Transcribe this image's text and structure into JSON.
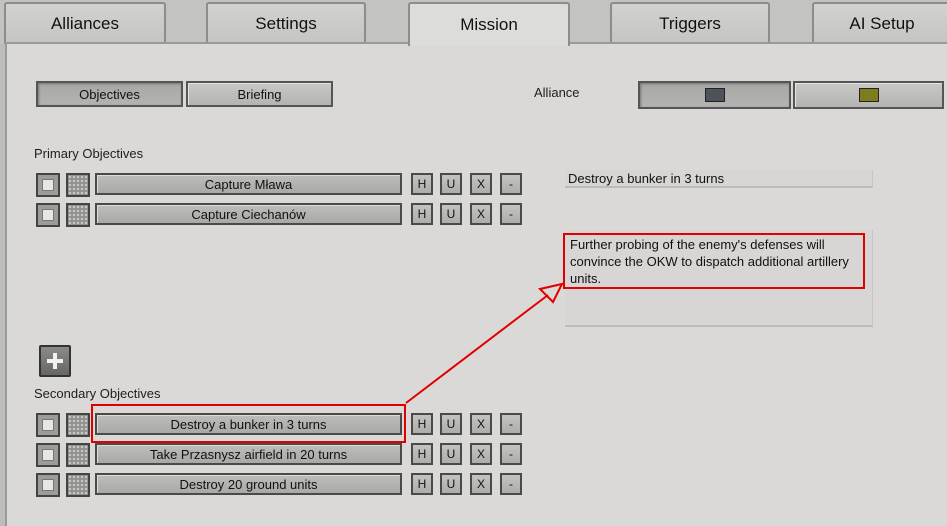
{
  "tabs": [
    {
      "label": "Alliances"
    },
    {
      "label": "Settings"
    },
    {
      "label": "Mission",
      "active": true
    },
    {
      "label": "Triggers"
    },
    {
      "label": "AI Setup"
    }
  ],
  "subtabs": {
    "objectives": "Objectives",
    "briefing": "Briefing",
    "active": "Objectives"
  },
  "alliance": {
    "label": "Alliance",
    "colors": [
      "#4e525a",
      "#7e7d1c"
    ]
  },
  "primary": {
    "heading": "Primary Objectives",
    "items": [
      "Capture Mława",
      "Capture Ciechanów"
    ]
  },
  "secondary": {
    "heading": "Secondary Objectives",
    "items": [
      "Destroy a bunker in 3 turns",
      "Take Przasnysz airfield in 20 turns",
      "Destroy 20 ground units"
    ]
  },
  "row_buttons": {
    "h": "H",
    "u": "U",
    "x": "X",
    "minus": "-"
  },
  "detail": {
    "title": "Destroy a bunker in 3 turns",
    "description": "Further probing of the enemy's defenses will convince the OKW to dispatch additional artillery units."
  },
  "annotation_color": "#e10000",
  "icons": [
    "checkbox-icon",
    "mesh-icon",
    "plus-icon"
  ]
}
